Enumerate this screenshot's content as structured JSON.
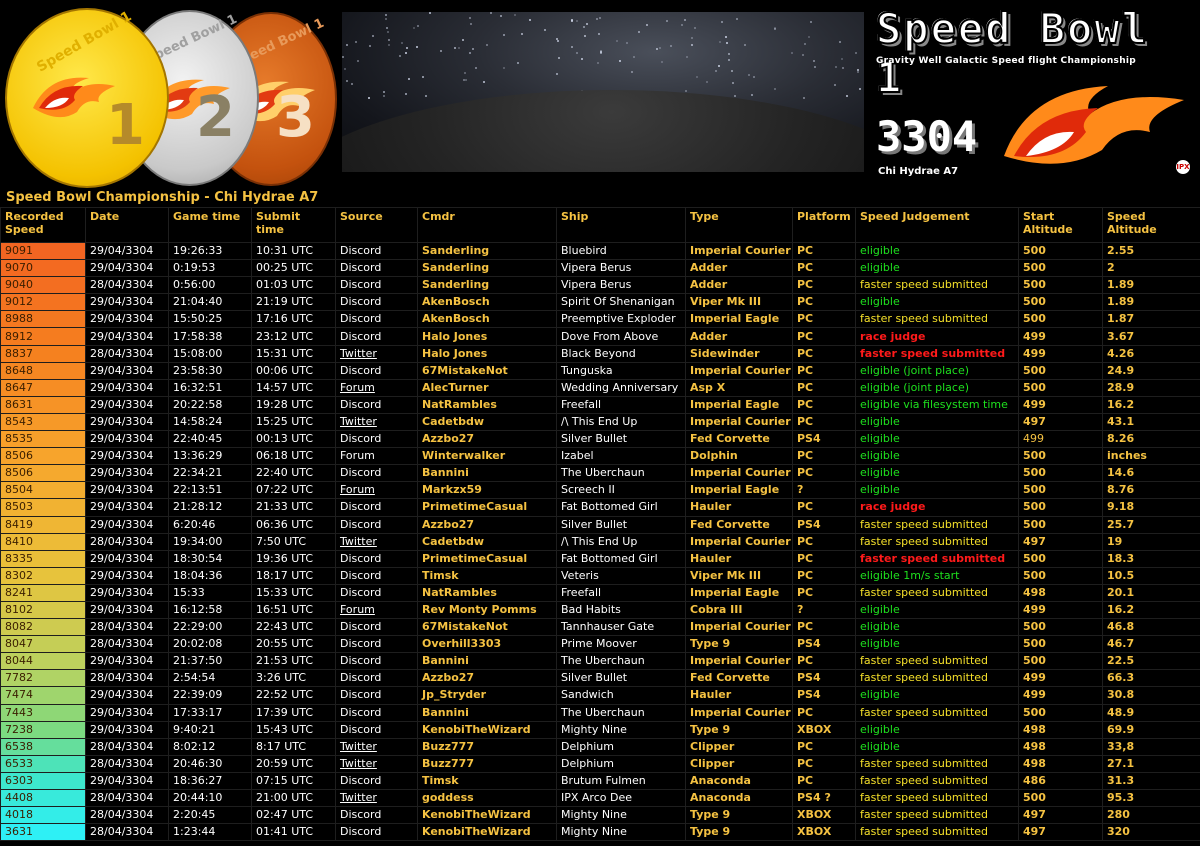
{
  "header": {
    "medals": [
      {
        "label": "Speed Bowl 1",
        "number": "1"
      },
      {
        "label": "Speed Bowl 1",
        "number": "2"
      },
      {
        "label": "Speed Bowl 1",
        "number": "3"
      }
    ],
    "logo": {
      "title": "Speed Bowl 1",
      "subtitle": "Gravity Well Galactic Speed flight Championship",
      "year": "3304",
      "location": "Chi Hydrae A7",
      "badge": "IPX"
    }
  },
  "table_title": "Speed Bowl Championship - Chi Hydrae A7",
  "columns": [
    "Recorded Speed",
    "Date",
    "Game time",
    "Submit time",
    "Source",
    "Cmdr",
    "Ship",
    "Type",
    "Platform",
    "Speed Judgement",
    "Start Altitude",
    "Speed Altitude"
  ],
  "colors": {
    "header_text": "#f5c242",
    "eligible": "#1ee11e",
    "faster": "#f5e02a",
    "race_judge": "#ff1a1a",
    "speed_gradient_top": "#f26522",
    "speed_gradient_bottom": "#2fe7f5"
  },
  "rows": [
    {
      "speed": "9091",
      "date": "29/04/3304",
      "game": "19:26:33",
      "submit": "10:31 UTC",
      "source": "Discord",
      "link": false,
      "cmdr": "Sanderling",
      "ship": "Bluebird",
      "type": "Imperial Courier",
      "platform": "PC",
      "judgement": "eligible",
      "jcolor": "eligible",
      "start": "500",
      "alt": "2.55"
    },
    {
      "speed": "9070",
      "date": "29/04/3304",
      "game": "0:19:53",
      "submit": "00:25 UTC",
      "source": "Discord",
      "link": false,
      "cmdr": "Sanderling",
      "ship": "Vipera Berus",
      "type": "Adder",
      "platform": "PC",
      "judgement": "eligible",
      "jcolor": "eligible",
      "start": "500",
      "alt": "2"
    },
    {
      "speed": "9040",
      "date": "28/04/3304",
      "game": "0:56:00",
      "submit": "01:03 UTC",
      "source": "Discord",
      "link": false,
      "cmdr": "Sanderling",
      "ship": "Vipera Berus",
      "type": "Adder",
      "platform": "PC",
      "judgement": "faster speed submitted",
      "jcolor": "faster",
      "start": "500",
      "alt": "1.89"
    },
    {
      "speed": "9012",
      "date": "29/04/3304",
      "game": "21:04:40",
      "submit": "21:19 UTC",
      "source": "Discord",
      "link": false,
      "cmdr": "AkenBosch",
      "ship": "Spirit Of Shenanigan",
      "type": "Viper Mk III",
      "platform": "PC",
      "judgement": "eligible",
      "jcolor": "eligible",
      "start": "500",
      "alt": "1.89"
    },
    {
      "speed": "8988",
      "date": "29/04/3304",
      "game": "15:50:25",
      "submit": "17:16 UTC",
      "source": "Discord",
      "link": false,
      "cmdr": "AkenBosch",
      "ship": "Preemptive Exploder",
      "type": "Imperial Eagle",
      "platform": "PC",
      "judgement": "faster speed submitted",
      "jcolor": "faster",
      "start": "500",
      "alt": "1.87"
    },
    {
      "speed": "8912",
      "date": "29/04/3304",
      "game": "17:58:38",
      "submit": "23:12 UTC",
      "source": "Discord",
      "link": false,
      "cmdr": "Halo Jones",
      "ship": "Dove From Above",
      "type": "Adder",
      "platform": "PC",
      "judgement": "race judge",
      "jcolor": "race_judge",
      "start": "499",
      "alt": "3.67"
    },
    {
      "speed": "8837",
      "date": "28/04/3304",
      "game": "15:08:00",
      "submit": "15:31 UTC",
      "source": "Twitter",
      "link": true,
      "cmdr": "Halo Jones",
      "ship": "Black Beyond",
      "type": "Sidewinder",
      "platform": "PC",
      "judgement": "faster speed submitted",
      "jcolor": "race_judge",
      "start": "499",
      "alt": "4.26"
    },
    {
      "speed": "8648",
      "date": "29/04/3304",
      "game": "23:58:30",
      "submit": "00:06 UTC",
      "source": "Discord",
      "link": false,
      "cmdr": "67MistakeNot",
      "ship": "Tunguska",
      "type": "Imperial Courier",
      "platform": "PC",
      "judgement": "eligible (joint place)",
      "jcolor": "eligible",
      "start": "500",
      "alt": "24.9"
    },
    {
      "speed": "8647",
      "date": "29/04/3304",
      "game": "16:32:51",
      "submit": "14:57 UTC",
      "source": "Forum",
      "link": true,
      "cmdr": "AlecTurner",
      "ship": "Wedding Anniversary",
      "type": "Asp X",
      "platform": "PC",
      "judgement": "eligible (joint place)",
      "jcolor": "eligible",
      "start": "500",
      "alt": "28.9"
    },
    {
      "speed": "8631",
      "date": "29/04/3304",
      "game": "20:22:58",
      "submit": "19:28 UTC",
      "source": "Discord",
      "link": false,
      "cmdr": "NatRambles",
      "ship": "Freefall",
      "type": "Imperial Eagle",
      "platform": "PC",
      "judgement": "eligible via filesystem time",
      "jcolor": "eligible",
      "start": "499",
      "alt": "16.2"
    },
    {
      "speed": "8543",
      "date": "29/04/3304",
      "game": "14:58:24",
      "submit": "15:25 UTC",
      "source": "Twitter",
      "link": true,
      "cmdr": "Cadetbdw",
      "ship": "/\\ This End Up",
      "type": "Imperial Courier",
      "platform": "PC",
      "judgement": "eligible",
      "jcolor": "eligible",
      "start": "497",
      "alt": "43.1"
    },
    {
      "speed": "8535",
      "date": "29/04/3304",
      "game": "22:40:45",
      "submit": "00:13 UTC",
      "source": "Discord",
      "link": false,
      "cmdr": "Azzbo27",
      "ship": "Silver Bullet",
      "type": "Fed Corvette",
      "platform": "PS4",
      "judgement": "eligible",
      "jcolor": "eligible",
      "start": "499",
      "alt": "8.26"
    },
    {
      "speed": "8506",
      "date": "29/04/3304",
      "game": "13:36:29",
      "submit": "06:18 UTC",
      "source": "Forum",
      "link": false,
      "cmdr": "Winterwalker",
      "ship": "Izabel",
      "type": "Dolphin",
      "platform": "PC",
      "judgement": "eligible",
      "jcolor": "eligible",
      "start": "500",
      "alt": "inches"
    },
    {
      "speed": "8506",
      "date": "29/04/3304",
      "game": "22:34:21",
      "submit": "22:40 UTC",
      "source": "Discord",
      "link": false,
      "cmdr": "Bannini",
      "ship": "The Uberchaun",
      "type": "Imperial Courier",
      "platform": "PC",
      "judgement": "eligible",
      "jcolor": "eligible",
      "start": "500",
      "alt": "14.6"
    },
    {
      "speed": "8504",
      "date": "29/04/3304",
      "game": "22:13:51",
      "submit": "07:22 UTC",
      "source": "Forum",
      "link": true,
      "cmdr": "Markzx59",
      "ship": "Screech II",
      "type": "Imperial Eagle",
      "platform": "?",
      "judgement": "eligible",
      "jcolor": "eligible",
      "start": "500",
      "alt": "8.76"
    },
    {
      "speed": "8503",
      "date": "29/04/3304",
      "game": "21:28:12",
      "submit": "21:33 UTC",
      "source": "Discord",
      "link": false,
      "cmdr": "PrimetimeCasual",
      "ship": "Fat Bottomed Girl",
      "type": "Hauler",
      "platform": "PC",
      "judgement": "race judge",
      "jcolor": "race_judge",
      "start": "500",
      "alt": "9.18"
    },
    {
      "speed": "8419",
      "date": "29/04/3304",
      "game": "6:20:46",
      "submit": "06:36 UTC",
      "source": "Discord",
      "link": false,
      "cmdr": "Azzbo27",
      "ship": "Silver Bullet",
      "type": "Fed Corvette",
      "platform": "PS4",
      "judgement": "faster speed submitted",
      "jcolor": "faster",
      "start": "500",
      "alt": "25.7"
    },
    {
      "speed": "8410",
      "date": "28/04/3304",
      "game": "19:34:00",
      "submit": "7:50 UTC",
      "source": "Twitter",
      "link": true,
      "cmdr": "Cadetbdw",
      "ship": "/\\ This End Up",
      "type": "Imperial Courier",
      "platform": "PC",
      "judgement": "faster speed submitted",
      "jcolor": "faster",
      "start": "497",
      "alt": "19"
    },
    {
      "speed": "8335",
      "date": "29/04/3304",
      "game": "18:30:54",
      "submit": "19:36 UTC",
      "source": "Discord",
      "link": false,
      "cmdr": "PrimetimeCasual",
      "ship": "Fat Bottomed Girl",
      "type": "Hauler",
      "platform": "PC",
      "judgement": "faster speed submitted",
      "jcolor": "race_judge",
      "start": "500",
      "alt": "18.3"
    },
    {
      "speed": "8302",
      "date": "29/04/3304",
      "game": "18:04:36",
      "submit": "18:17 UTC",
      "source": "Discord",
      "link": false,
      "cmdr": "Timsk",
      "ship": "Veteris",
      "type": "Viper Mk III",
      "platform": "PC",
      "judgement": "eligible 1m/s start",
      "jcolor": "eligible",
      "start": "500",
      "alt": "10.5"
    },
    {
      "speed": "8241",
      "date": "29/04/3304",
      "game": "15:33",
      "submit": "15:33 UTC",
      "source": "Discord",
      "link": false,
      "cmdr": "NatRambles",
      "ship": "Freefall",
      "type": "Imperial Eagle",
      "platform": "PC",
      "judgement": "faster speed submitted",
      "jcolor": "faster",
      "start": "498",
      "alt": "20.1"
    },
    {
      "speed": "8102",
      "date": "29/04/3304",
      "game": "16:12:58",
      "submit": "16:51 UTC",
      "source": "Forum",
      "link": true,
      "cmdr": "Rev Monty Pomms",
      "ship": "Bad Habits",
      "type": "Cobra III",
      "platform": "?",
      "judgement": "eligible",
      "jcolor": "eligible",
      "start": "499",
      "alt": "16.2"
    },
    {
      "speed": "8082",
      "date": "28/04/3304",
      "game": "22:29:00",
      "submit": "22:43 UTC",
      "source": "Discord",
      "link": false,
      "cmdr": "67MistakeNot",
      "ship": "Tannhauser Gate",
      "type": "Imperial Courier",
      "platform": "PC",
      "judgement": "eligible",
      "jcolor": "eligible",
      "start": "500",
      "alt": "46.8"
    },
    {
      "speed": "8047",
      "date": "28/04/3304",
      "game": "20:02:08",
      "submit": "20:55 UTC",
      "source": "Discord",
      "link": false,
      "cmdr": "Overhill3303",
      "ship": "Prime Moover",
      "type": "Type 9",
      "platform": "PS4",
      "judgement": "eligible",
      "jcolor": "eligible",
      "start": "500",
      "alt": "46.7"
    },
    {
      "speed": "8044",
      "date": "29/04/3304",
      "game": "21:37:50",
      "submit": "21:53 UTC",
      "source": "Discord",
      "link": false,
      "cmdr": "Bannini",
      "ship": "The Uberchaun",
      "type": "Imperial Courier",
      "platform": "PC",
      "judgement": "faster speed submitted",
      "jcolor": "faster",
      "start": "500",
      "alt": "22.5"
    },
    {
      "speed": "7782",
      "date": "28/04/3304",
      "game": "2:54:54",
      "submit": "3:26 UTC",
      "source": "Discord",
      "link": false,
      "cmdr": "Azzbo27",
      "ship": "Silver Bullet",
      "type": "Fed Corvette",
      "platform": "PS4",
      "judgement": "faster speed submitted",
      "jcolor": "faster",
      "start": "499",
      "alt": "66.3"
    },
    {
      "speed": "7474",
      "date": "29/04/3304",
      "game": "22:39:09",
      "submit": "22:52 UTC",
      "source": "Discord",
      "link": false,
      "cmdr": "Jp_Stryder",
      "ship": "Sandwich",
      "type": "Hauler",
      "platform": "PS4",
      "judgement": "eligible",
      "jcolor": "eligible",
      "start": "499",
      "alt": "30.8"
    },
    {
      "speed": "7443",
      "date": "29/04/3304",
      "game": "17:33:17",
      "submit": "17:39 UTC",
      "source": "Discord",
      "link": false,
      "cmdr": "Bannini",
      "ship": "The Uberchaun",
      "type": "Imperial Courier",
      "platform": "PC",
      "judgement": "faster speed submitted",
      "jcolor": "faster",
      "start": "500",
      "alt": "48.9"
    },
    {
      "speed": "7238",
      "date": "29/04/3304",
      "game": "9:40:21",
      "submit": "15:43 UTC",
      "source": "Discord",
      "link": false,
      "cmdr": "KenobiTheWizard",
      "ship": "Mighty Nine",
      "type": "Type 9",
      "platform": "XBOX",
      "judgement": "eligible",
      "jcolor": "eligible",
      "start": "498",
      "alt": "69.9"
    },
    {
      "speed": "6538",
      "date": "28/04/3304",
      "game": "8:02:12",
      "submit": "8:17 UTC",
      "source": "Twitter",
      "link": true,
      "cmdr": "Buzz777",
      "ship": "Delphium",
      "type": "Clipper",
      "platform": "PC",
      "judgement": "eligible",
      "jcolor": "eligible",
      "start": "498",
      "alt": "33,8"
    },
    {
      "speed": "6533",
      "date": "28/04/3304",
      "game": "20:46:30",
      "submit": "20:59 UTC",
      "source": "Twitter",
      "link": true,
      "cmdr": "Buzz777",
      "ship": "Delphium",
      "type": "Clipper",
      "platform": "PC",
      "judgement": "faster speed submitted",
      "jcolor": "faster",
      "start": "498",
      "alt": "27.1"
    },
    {
      "speed": "6303",
      "date": "29/04/3304",
      "game": "18:36:27",
      "submit": "07:15 UTC",
      "source": "Discord",
      "link": false,
      "cmdr": "Timsk",
      "ship": "Brutum Fulmen",
      "type": "Anaconda",
      "platform": "PC",
      "judgement": "faster speed submitted",
      "jcolor": "faster",
      "start": "486",
      "alt": "31.3"
    },
    {
      "speed": "4408",
      "date": "28/04/3304",
      "game": "20:44:10",
      "submit": "21:00 UTC",
      "source": "Twitter",
      "link": true,
      "cmdr": "goddess",
      "ship": "IPX Arco Dee",
      "type": "Anaconda",
      "platform": "PS4 ?",
      "judgement": "faster speed submitted",
      "jcolor": "faster",
      "start": "500",
      "alt": "95.3"
    },
    {
      "speed": "4018",
      "date": "28/04/3304",
      "game": "2:20:45",
      "submit": "02:47 UTC",
      "source": "Discord",
      "link": false,
      "cmdr": "KenobiTheWizard",
      "ship": "Mighty Nine",
      "type": "Type 9",
      "platform": "XBOX",
      "judgement": "faster speed submitted",
      "jcolor": "faster",
      "start": "497",
      "alt": "280"
    },
    {
      "speed": "3631",
      "date": "28/04/3304",
      "game": "1:23:44",
      "submit": "01:41 UTC",
      "source": "Discord",
      "link": false,
      "cmdr": "KenobiTheWizard",
      "ship": "Mighty Nine",
      "type": "Type 9",
      "platform": "XBOX",
      "judgement": "faster speed submitted",
      "jcolor": "faster",
      "start": "497",
      "alt": "320"
    }
  ]
}
